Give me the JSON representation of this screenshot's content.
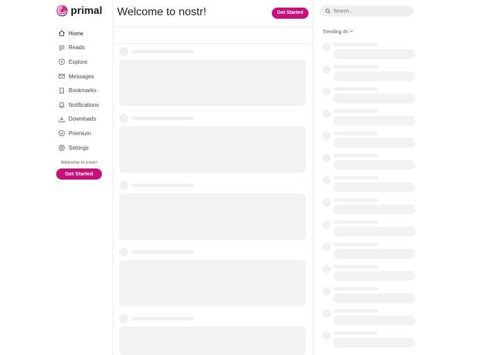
{
  "brand": {
    "name": "primal",
    "accent": "#c80e7d"
  },
  "sidebar": {
    "items": [
      {
        "label": "Home",
        "icon": "home-icon",
        "active": true
      },
      {
        "label": "Reads",
        "icon": "reads-icon"
      },
      {
        "label": "Explore",
        "icon": "compass-icon"
      },
      {
        "label": "Messages",
        "icon": "envelope-icon"
      },
      {
        "label": "Bookmarks",
        "icon": "bookmark-icon"
      },
      {
        "label": "Notifications",
        "icon": "bell-icon"
      },
      {
        "label": "Downloads",
        "icon": "download-icon"
      },
      {
        "label": "Premium",
        "icon": "check-badge-icon"
      },
      {
        "label": "Settings",
        "icon": "gear-icon"
      }
    ],
    "welcome_text": "Welcome to nostr!",
    "cta_label": "Get Started"
  },
  "main": {
    "title": "Welcome to nostr!",
    "cta_label": "Get Started"
  },
  "right": {
    "search_placeholder": "Search...",
    "trending_label": "Trending 4h"
  }
}
